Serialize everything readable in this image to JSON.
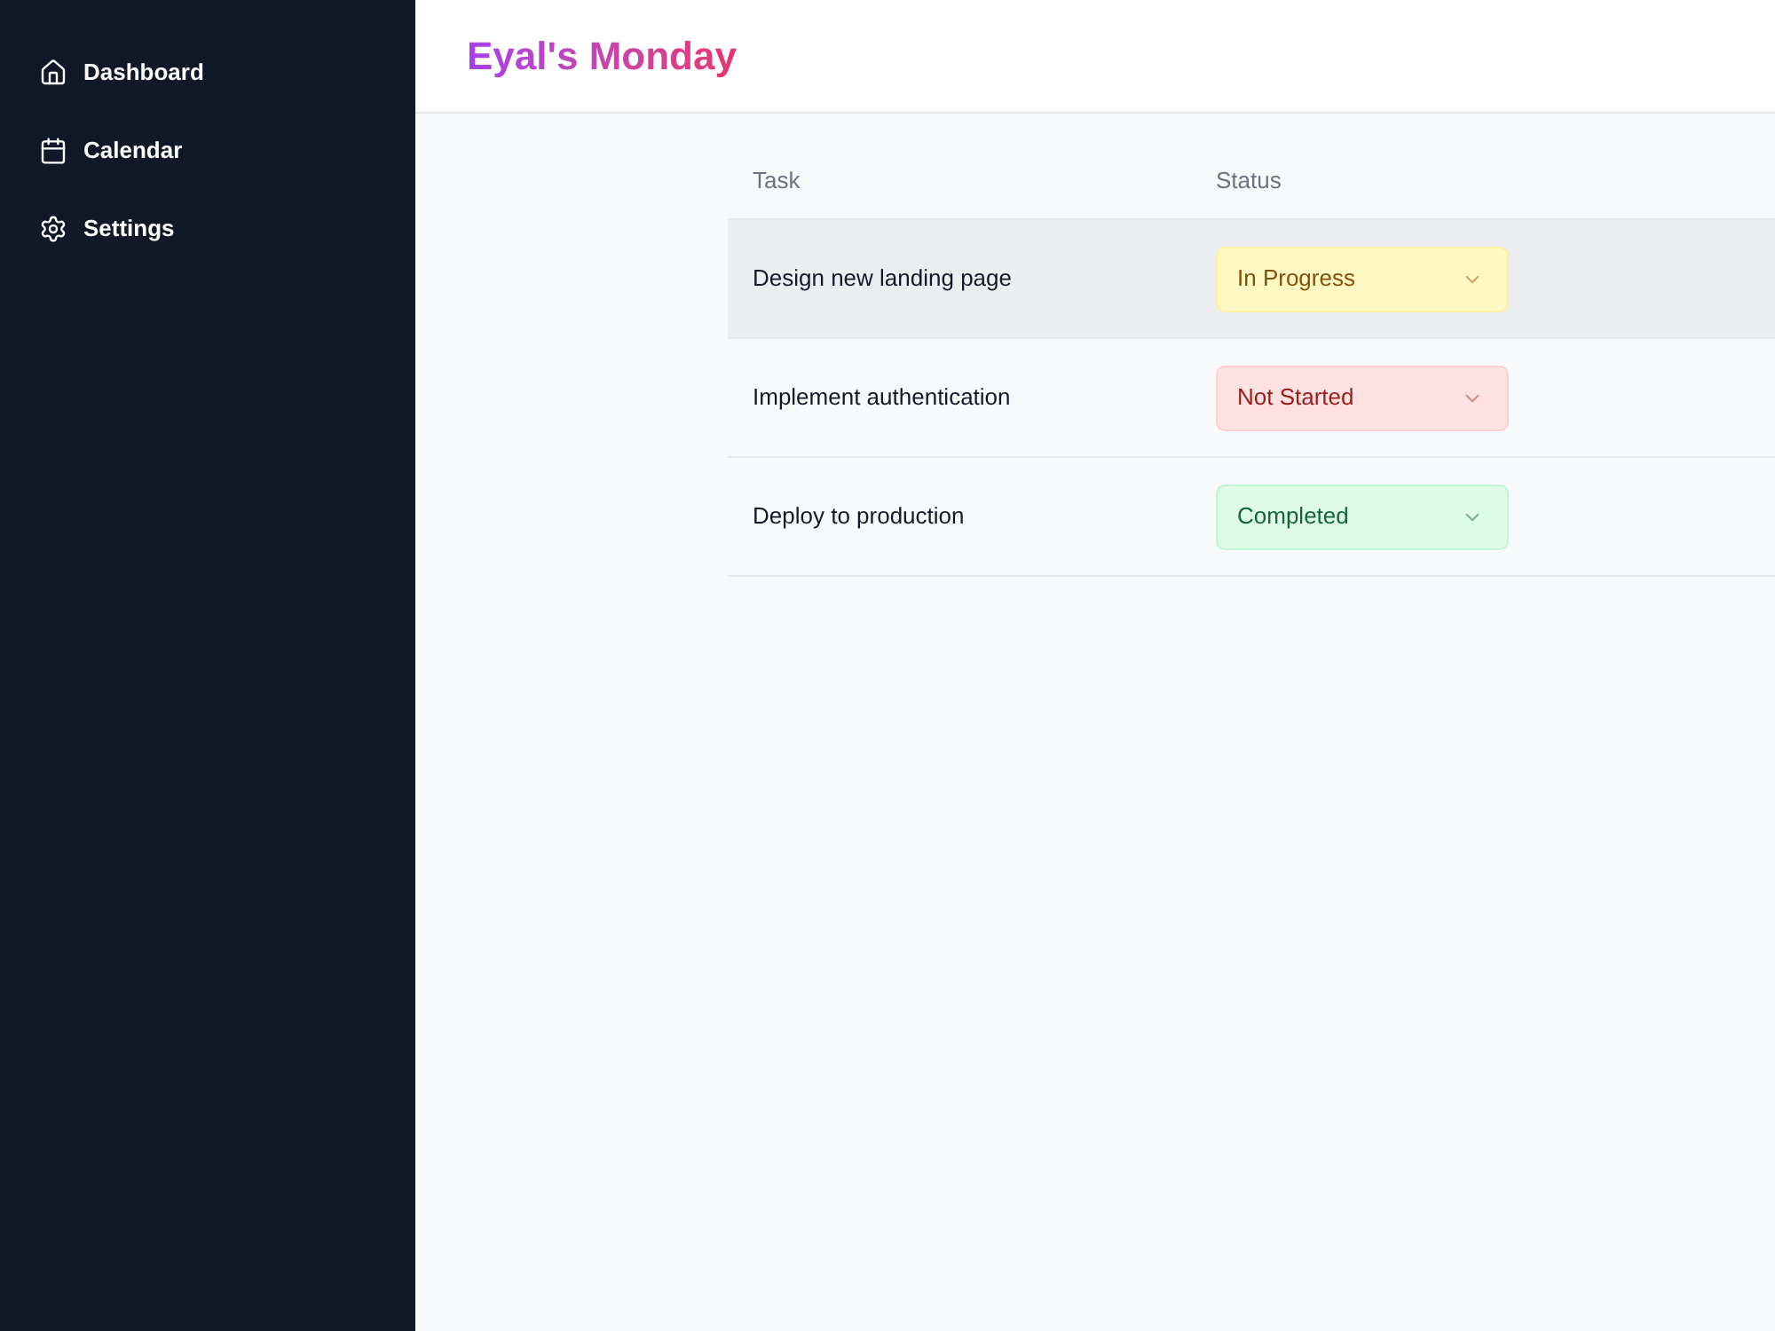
{
  "sidebar": {
    "items": [
      {
        "label": "Dashboard"
      },
      {
        "label": "Calendar"
      },
      {
        "label": "Settings"
      }
    ]
  },
  "header": {
    "title": "Eyal's Monday"
  },
  "table": {
    "columns": [
      "Task",
      "Status"
    ],
    "rows": [
      {
        "task": "Design new landing page",
        "highlighted": true,
        "status": {
          "label": "In Progress",
          "kind": "in_progress"
        }
      },
      {
        "task": "Implement authentication",
        "highlighted": false,
        "status": {
          "label": "Not Started",
          "kind": "not_started"
        }
      },
      {
        "task": "Deploy to production",
        "highlighted": false,
        "status": {
          "label": "Completed",
          "kind": "completed"
        }
      }
    ]
  }
}
